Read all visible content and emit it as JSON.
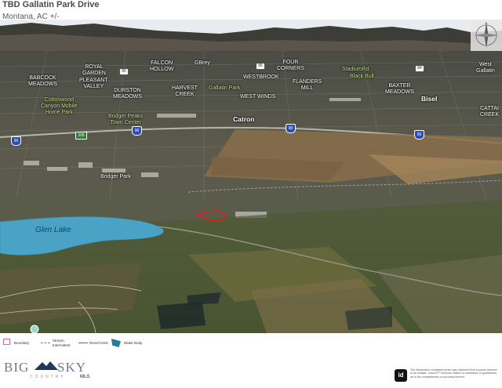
{
  "header": {
    "title": "TBD Gallatin Park Drive",
    "subtitle": "Montana, AC +/-"
  },
  "map": {
    "places": [
      {
        "id": "babcock",
        "text": "BABCOCK\nMEADOWS"
      },
      {
        "id": "royal",
        "text": "ROYAL\nGARDEN"
      },
      {
        "id": "pleasant",
        "text": "PLEASANT\nVALLEY"
      },
      {
        "id": "falcon",
        "text": "FALCON\nHOLLOW"
      },
      {
        "id": "gibrey",
        "text": "GBrey"
      },
      {
        "id": "four",
        "text": "FOUR\nCORNERS"
      },
      {
        "id": "westgallatin",
        "text": "West\nGallatin"
      },
      {
        "id": "durston",
        "text": "DURSTON\nMEADOWS"
      },
      {
        "id": "harvest",
        "text": "HARVEST\nCREEK"
      },
      {
        "id": "westbrook",
        "text": "WESTBROOK"
      },
      {
        "id": "flanders",
        "text": "FLANDERS\nMILL"
      },
      {
        "id": "baxter",
        "text": "BAXTER\nMEADOWS"
      },
      {
        "id": "westwinds",
        "text": "WEST WINDS"
      },
      {
        "id": "bisel",
        "text": "Bisel"
      },
      {
        "id": "catron",
        "text": "CATTAI\nCREEK"
      },
      {
        "id": "gatron",
        "text": "Catron"
      },
      {
        "id": "bridgerpark",
        "text": "Bridger Park"
      }
    ],
    "green_labels": [
      {
        "id": "cottonwood",
        "text": "Cottonwood\nCanyon Mobile\nHome Park"
      },
      {
        "id": "bridgerpeaks",
        "text": "Bridger Peaks\nTown Center"
      },
      {
        "id": "gallatinpark",
        "text": "Gallatin Park"
      },
      {
        "id": "blackbull",
        "text": "Black Bull"
      },
      {
        "id": "stadium",
        "text": "StadiumRd"
      }
    ],
    "lake_name": "Glen Lake",
    "shields": [
      {
        "id": "i90a",
        "text": "90"
      },
      {
        "id": "i90b",
        "text": "90"
      },
      {
        "id": "i90c",
        "text": "90"
      },
      {
        "id": "i90d",
        "text": "90"
      },
      {
        "id": "r85a",
        "text": "85"
      },
      {
        "id": "r85b",
        "text": "85"
      },
      {
        "id": "r84",
        "text": "84"
      },
      {
        "id": "g205",
        "text": "205"
      }
    ],
    "compass_icon": "compass-rose-icon",
    "subject_boundary_color": "#e02020",
    "lake_color": "#4aa3c4"
  },
  "legend": {
    "items": [
      {
        "label": "Boundary",
        "color": "#d86a8a"
      },
      {
        "label": "Stream,\nIntermittent",
        "color": "#6a8aa8"
      },
      {
        "label": "River/Creek",
        "color": "#3a6ea0"
      },
      {
        "label": "Water Body",
        "color": "#2a7a9a"
      }
    ]
  },
  "brand": {
    "line1": "BIG",
    "line2": "SKY",
    "tag": "COUNTRY",
    "mls": "MLS"
  },
  "disclaimer": {
    "badge": "id",
    "text": "The information contained herein was obtained from sources deemed to be reliable. Land id™ Services makes no warranties or guarantees as to the completeness or accuracy thereof."
  }
}
